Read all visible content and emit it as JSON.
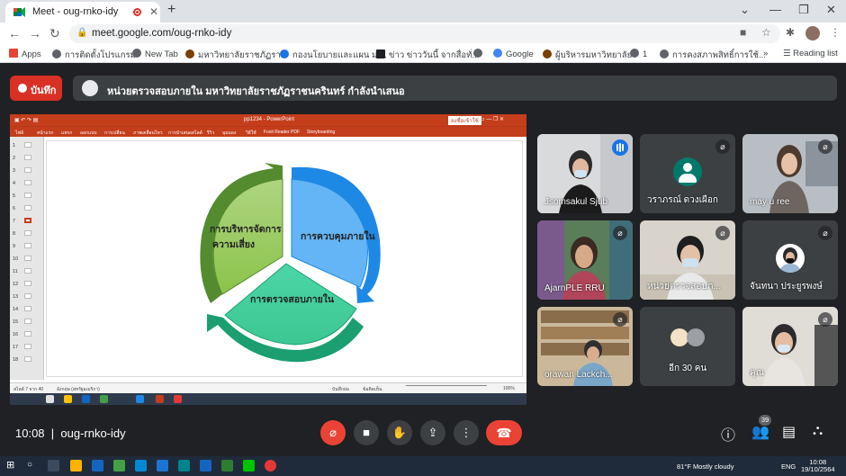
{
  "browser": {
    "tab_title": "Meet - oug-rnko-idy",
    "url": "meet.google.com/oug-rnko-idy",
    "bookmarks": [
      {
        "label": "Apps",
        "color": "#ea4335"
      },
      {
        "label": "การติดตั้งโปรแกรม",
        "color": "#5f6368"
      },
      {
        "label": "New Tab",
        "color": "#5f6368"
      },
      {
        "label": "มหาวิทยาลัยราชภัฏรา...",
        "color": "#7b3f00"
      },
      {
        "label": "กองนโยบายและแผน ม....",
        "color": "#1a73e8"
      },
      {
        "label": "ข่าว ข่าววันนี้ จากสื่อทั่...",
        "color": "#202124"
      },
      {
        "label": "Google",
        "color": "#5f6368"
      },
      {
        "label": "ผู้บริหารมหาวิทยาลัย",
        "color": "#7b3f00"
      },
      {
        "label": "1",
        "color": "#5f6368"
      },
      {
        "label": "การคงสภาพสิทธิ์การใช้...",
        "color": "#5f6368"
      }
    ],
    "reading_list": "Reading list"
  },
  "meet": {
    "record_label": "บันทึก",
    "presenting_text": "หน่วยตรวจสอบภายใน มหาวิทยาลัยราชภัฏราชนครินทร์ กำลังนำเสนอ",
    "meeting_time": "10:08",
    "meeting_code": "oug-rnko-idy",
    "people_count": "39",
    "participants": [
      {
        "name": "Jsomsakul Sjub",
        "speaking": true
      },
      {
        "name": "วราภรณ์ ดวงเผือก",
        "speaking": false
      },
      {
        "name": "may u ree",
        "speaking": false
      },
      {
        "name": "AjarnPLE RRU",
        "speaking": false
      },
      {
        "name": "หน่วยตรวจสอบภ...",
        "speaking": false
      },
      {
        "name": "จันทนา ประยูรพงษ์",
        "speaking": false
      },
      {
        "name": "orawan Lackch...",
        "speaking": false
      },
      {
        "name": "อีก 30 คน",
        "speaking": false
      },
      {
        "name": "คุณ",
        "speaking": false
      }
    ]
  },
  "slide": {
    "app_title": "pp1234 - PowerPoint",
    "ribbon_tabs": [
      "ไฟล์",
      "หน้าแรก",
      "แทรก",
      "ออกแบบ",
      "การเปลี่ยน",
      "ภาพเคลื่อนไหว",
      "การนำเสนอสไลด์",
      "รีวิว",
      "มุมมอง",
      "วิธีใช้",
      "Foxit Reader PDF",
      "Storyboarding"
    ],
    "sign_in": "ลงชื่อเข้าใช้",
    "thumb_numbers": [
      "1",
      "2",
      "3",
      "4",
      "5",
      "6",
      "7",
      "8",
      "9",
      "10",
      "11",
      "12",
      "13",
      "14",
      "15",
      "16",
      "17",
      "18"
    ],
    "segments": {
      "left_line1": "การบริหารจัดการ",
      "left_line2": "ความเสี่ยง",
      "right": "การควบคุมภายใน",
      "bottom": "การตรวจสอบภายใน"
    },
    "status_left": "สไลด์ 7 จาก 40",
    "status_lang": "อังกฤษ (สหรัฐอเมริกา)",
    "status_notes": "บันทึกย่อ",
    "status_comments": "ข้อคิดเห็น",
    "zoom": "100%"
  },
  "taskbar": {
    "weather": "81°F  Mostly cloudy",
    "lang": "ENG",
    "time": "10:08",
    "date": "19/10/2564"
  },
  "colors": {
    "green": "#7cb342",
    "blue": "#42a5f5",
    "teal": "#26a69a",
    "record_red": "#d93025",
    "meet_bg": "#202124"
  }
}
